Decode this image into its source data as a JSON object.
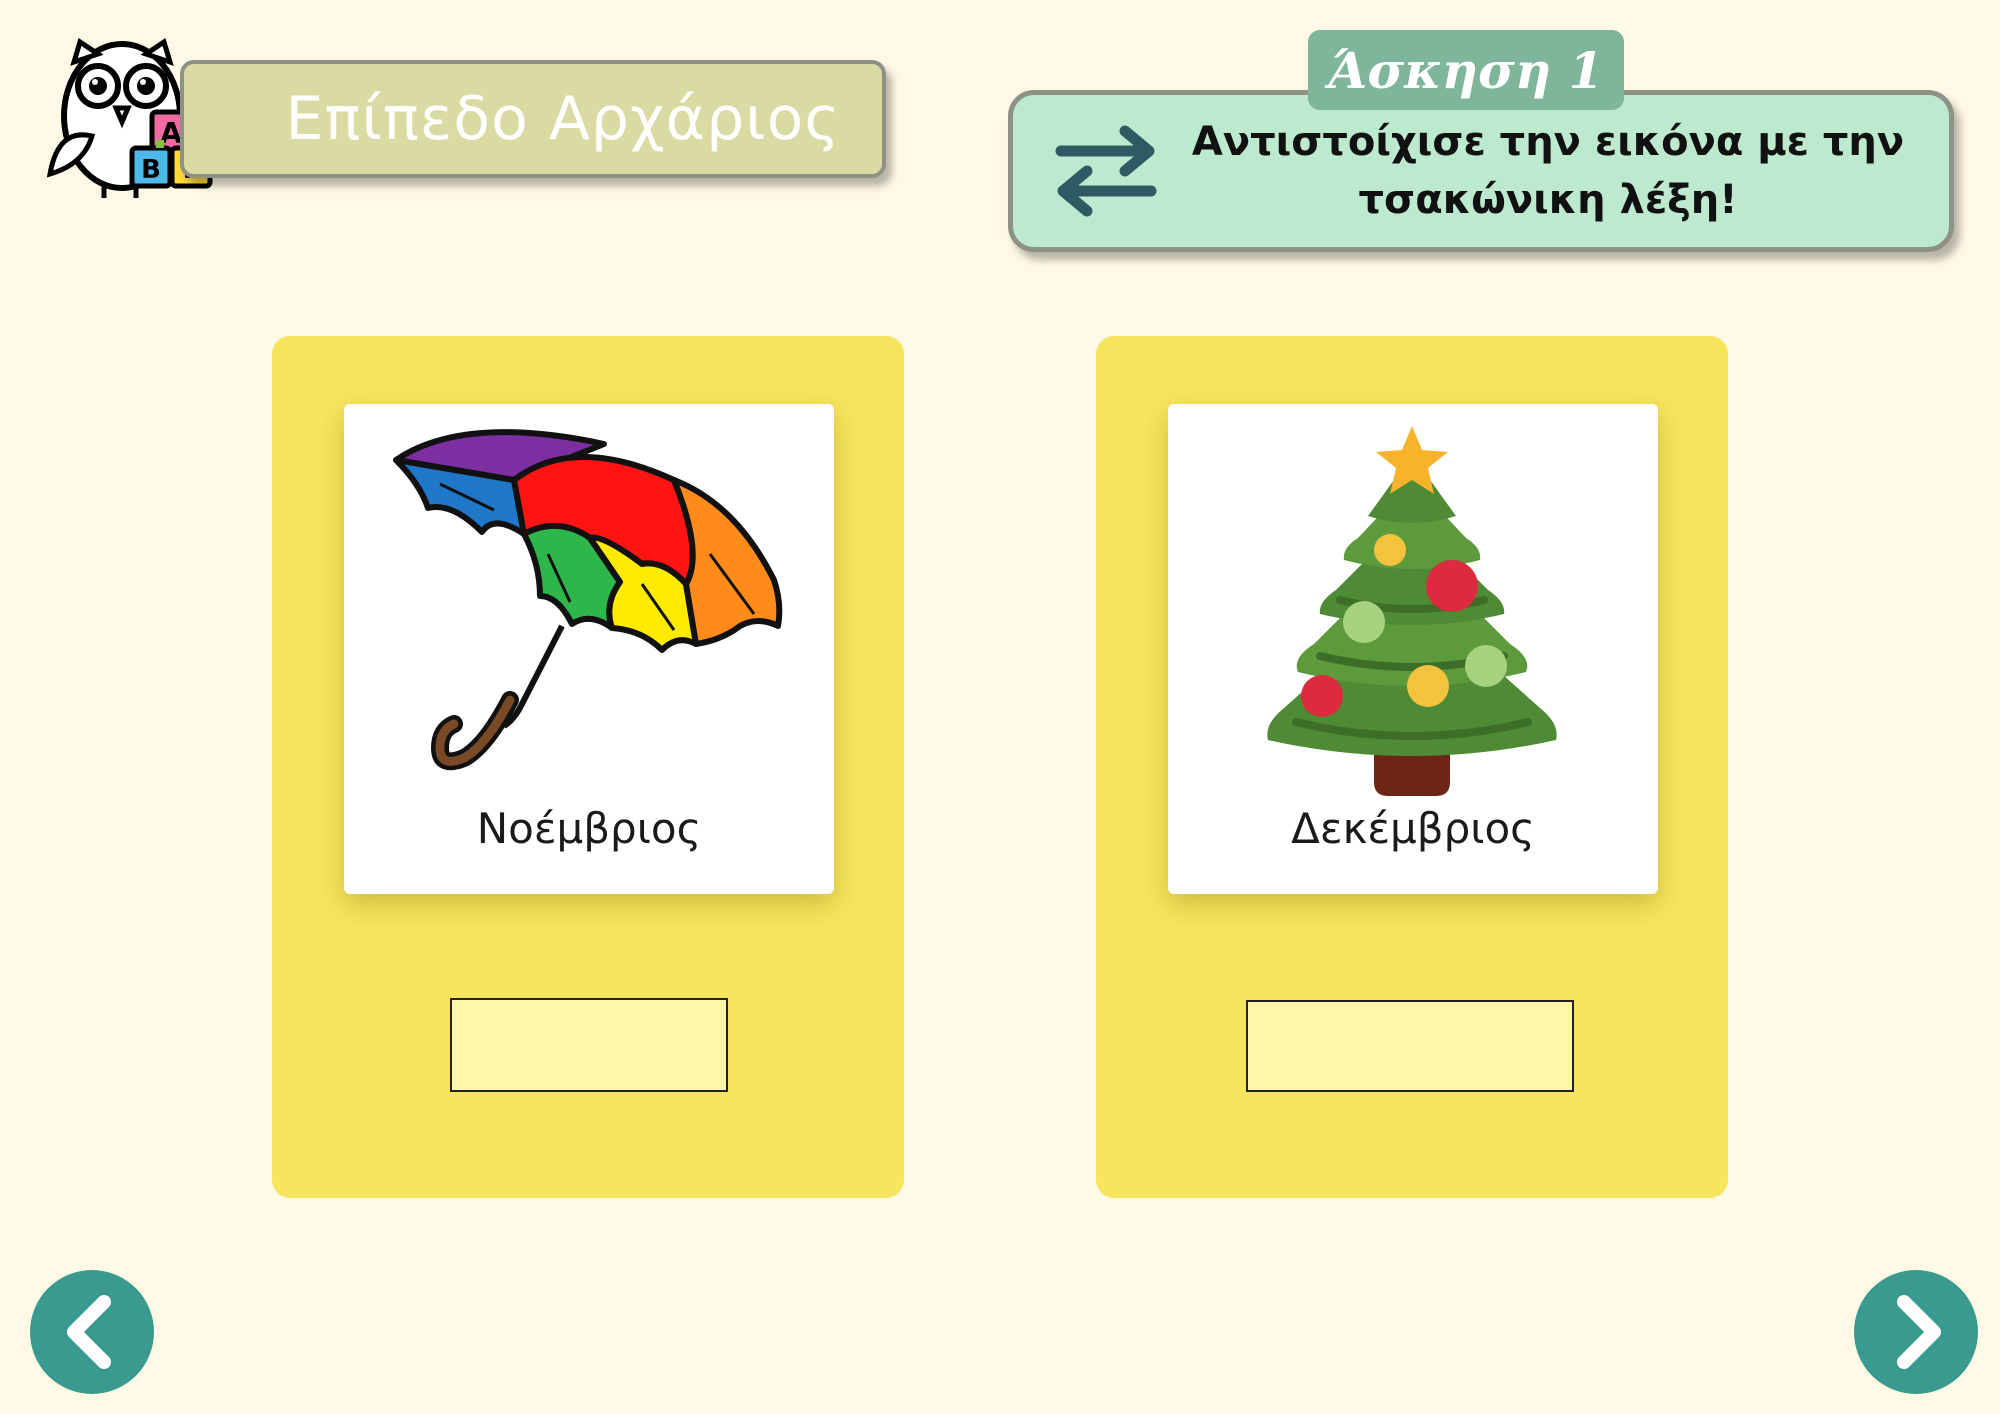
{
  "level": {
    "title": "Επίπεδο Αρχάριος"
  },
  "logo": {
    "icon": "owl-abc-blocks-icon",
    "blocks": [
      "Α",
      "Β",
      "Γ"
    ]
  },
  "exercise": {
    "tag": "Άσκηση 1",
    "instruction": "Αντιστοίχισε την εικόνα με την τσακώνικη λέξη!",
    "icon": "swap-arrows-icon"
  },
  "cards": [
    {
      "image": "umbrella-icon",
      "label": "Νοέμβριος",
      "answer": ""
    },
    {
      "image": "christmas-tree-icon",
      "label": "Δεκέμβριος",
      "answer": ""
    }
  ],
  "navigation": {
    "prev_icon": "chevron-left-icon",
    "next_icon": "chevron-right-icon"
  },
  "colors": {
    "background": "#fef8e6",
    "level_banner": "#d9dba2",
    "instruction_box": "#bdeacf",
    "exercise_tag": "#7fb59a",
    "card": "#f7e55e",
    "drop_slot": "#fdf5a9",
    "nav_button": "#3a9a90"
  }
}
